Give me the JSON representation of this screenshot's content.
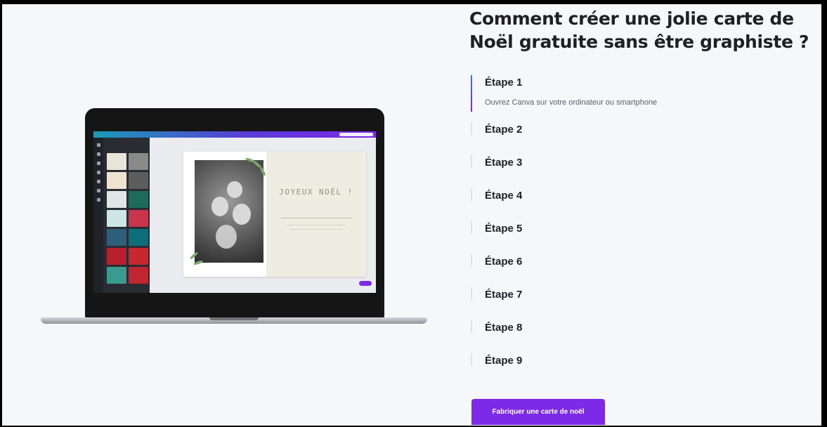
{
  "heading": "Comment créer une jolie carte de Noël gratuite sans être graphiste ?",
  "steps": [
    {
      "label": "Étape 1",
      "description": "Ouvrez Canva sur votre ordinateur ou smartphone",
      "active": true
    },
    {
      "label": "Étape 2"
    },
    {
      "label": "Étape 3"
    },
    {
      "label": "Étape 4"
    },
    {
      "label": "Étape 5"
    },
    {
      "label": "Étape 6"
    },
    {
      "label": "Étape 7"
    },
    {
      "label": "Étape 8"
    },
    {
      "label": "Étape 9"
    }
  ],
  "cta_label": "Fabriquer une carte de noël",
  "illustration": {
    "card_title": "JOYEUX NOËL !"
  },
  "colors": {
    "accent": "#7d2ae8",
    "background": "#f6f7f8",
    "heading": "#1f1f24"
  }
}
